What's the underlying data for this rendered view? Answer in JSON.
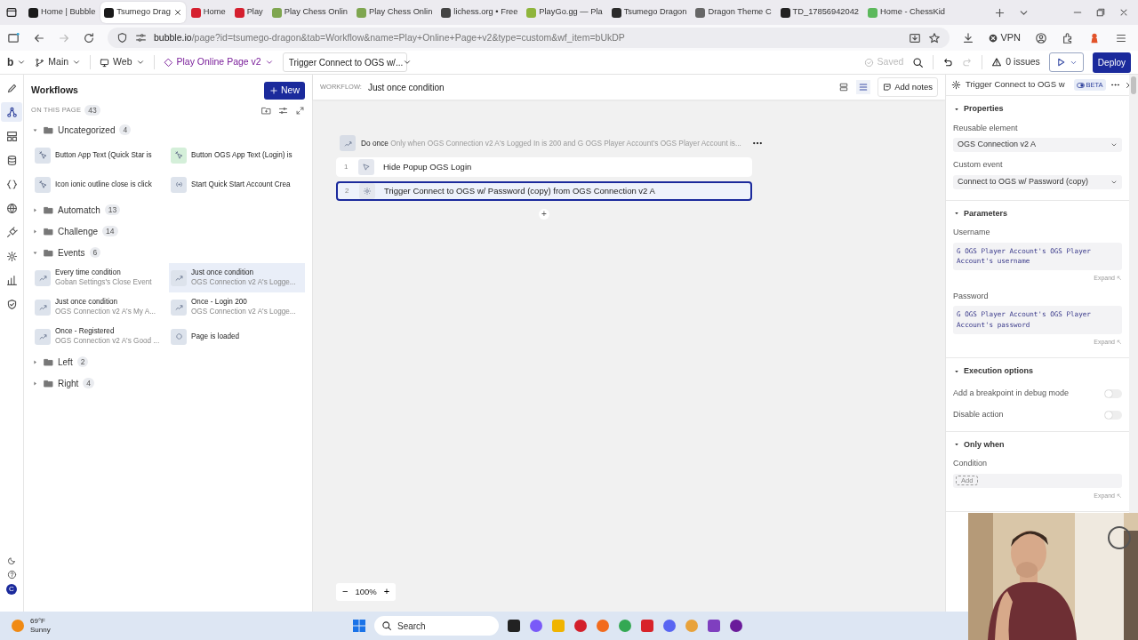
{
  "browser": {
    "tabs": [
      {
        "label": "Home | Bubble",
        "selected": false,
        "color": "#1a1a1a"
      },
      {
        "label": "Tsumego Drag",
        "selected": true,
        "color": "#1a1a1a"
      },
      {
        "label": "Home",
        "selected": false,
        "color": "#d5202f"
      },
      {
        "label": "Play",
        "selected": false,
        "color": "#d5202f"
      },
      {
        "label": "Play Chess Onlin",
        "selected": false,
        "color": "#7fa650"
      },
      {
        "label": "Play Chess Onlin",
        "selected": false,
        "color": "#7fa650"
      },
      {
        "label": "lichess.org • Free",
        "selected": false,
        "color": "#444444"
      },
      {
        "label": "PlayGo.gg — Pla",
        "selected": false,
        "color": "#8fb53c"
      },
      {
        "label": "Tsumego Dragon",
        "selected": false,
        "color": "#2b2b2b"
      },
      {
        "label": "Dragon Theme C",
        "selected": false,
        "color": "#666666"
      },
      {
        "label": "TD_17856942042",
        "selected": false,
        "color": "#222222"
      },
      {
        "label": "Home - ChessKid",
        "selected": false,
        "color": "#5cb85c"
      }
    ],
    "url_host": "bubble.io",
    "url_path": "/page?id=tsumego-dragon&tab=Workflow&name=Play+Online+Page+v2&type=custom&wf_item=bUkDP",
    "vpn": "VPN"
  },
  "editor_bar": {
    "logo": "b",
    "branch": "Main",
    "platform": "Web",
    "page": "Play Online Page v2",
    "element": "Trigger Connect to OGS w/...",
    "saved": "Saved",
    "issues": "0 issues",
    "deploy": "Deploy"
  },
  "rail": [
    {
      "kind": "design",
      "selected": false
    },
    {
      "kind": "workflow",
      "selected": true
    },
    {
      "kind": "styles",
      "selected": false
    },
    {
      "kind": "data",
      "selected": false
    },
    {
      "kind": "api",
      "selected": false
    },
    {
      "kind": "language",
      "selected": false
    },
    {
      "kind": "plugins",
      "selected": false
    },
    {
      "kind": "settings",
      "selected": false
    },
    {
      "kind": "logs",
      "selected": false
    },
    {
      "kind": "security",
      "selected": false
    }
  ],
  "user_initial": "C",
  "workflows": {
    "title": "Workflows",
    "new_button": "New",
    "section": "ON THIS PAGE",
    "count": "43",
    "folders": [
      {
        "name": "Uncategorized",
        "count": "4",
        "expanded": true,
        "items": [
          {
            "title": "Button App Text (Quick Star is",
            "kind": "click",
            "color": "#dde3ec",
            "selected": false
          },
          {
            "title": "Button OGS App Text (Login) is",
            "kind": "click",
            "color": "#d4efd9",
            "selected": false
          },
          {
            "title": "Icon ionic outline close is click",
            "kind": "click",
            "color": "#dde3ec",
            "selected": false
          },
          {
            "title": "Start Quick Start Account Crea",
            "kind": "custom",
            "color": "#dde3ec",
            "selected": false
          }
        ]
      },
      {
        "name": "Automatch",
        "count": "13",
        "expanded": false
      },
      {
        "name": "Challenge",
        "count": "14",
        "expanded": false
      },
      {
        "name": "Events",
        "count": "6",
        "expanded": true,
        "items": [
          {
            "title": "Every time condition",
            "subtitle": "Goban Settings's Close Event",
            "kind": "condition",
            "color": "#dde3ec",
            "selected": false
          },
          {
            "title": "Just once condition",
            "subtitle": "OGS Connection v2 A's Logge...",
            "kind": "condition",
            "color": "#dde3ec",
            "selected": true
          },
          {
            "title": "Just once condition",
            "subtitle": "OGS Connection v2 A's My A...",
            "kind": "condition",
            "color": "#dde3ec",
            "selected": false
          },
          {
            "title": "Once - Login 200",
            "subtitle": "OGS Connection v2 A's Logge...",
            "kind": "condition",
            "color": "#dde3ec",
            "selected": false
          },
          {
            "title": "Once - Registered",
            "subtitle": "OGS Connection v2 A's Good ...",
            "kind": "condition",
            "color": "#dde3ec",
            "selected": false
          },
          {
            "title": "Page is loaded",
            "kind": "load",
            "color": "#dde3ec",
            "selected": false
          }
        ]
      },
      {
        "name": "Left",
        "count": "2",
        "expanded": false
      },
      {
        "name": "Right",
        "count": "4",
        "expanded": false
      }
    ]
  },
  "canvas": {
    "label": "WORKFLOW:",
    "name": "Just once condition",
    "add_notes": "Add notes",
    "event": {
      "title": "Do once",
      "condition": "Only when OGS Connection v2 A's Logged In is 200 and G OGS Player Account's OGS Player Account is..."
    },
    "actions": [
      {
        "number": "1",
        "title": "Hide Popup OGS Login",
        "kind": "element",
        "selected": false
      },
      {
        "number": "2",
        "title": "Trigger Connect to OGS w/ Password (copy) from OGS Connection v2 A",
        "kind": "custom",
        "selected": true
      }
    ],
    "add_step": "+",
    "zoom_out": "−",
    "zoom": "100%",
    "zoom_in": "+"
  },
  "properties": {
    "title": "Trigger Connect to OGS w",
    "badge": "BETA",
    "sections": [
      {
        "title": "Properties",
        "expanded": true,
        "fields": [
          {
            "kind": "select",
            "label": "Reusable element",
            "value": "OGS Connection v2 A"
          },
          {
            "kind": "select",
            "label": "Custom event",
            "value": "Connect to OGS w/ Password (copy)"
          }
        ]
      },
      {
        "title": "Parameters",
        "expanded": true,
        "fields": [
          {
            "kind": "expression",
            "label": "Username",
            "value": "G OGS Player Account's OGS Player Account's username",
            "expand": "Expand"
          },
          {
            "kind": "expression",
            "label": "Password",
            "value": "G OGS Player Account's OGS Player Account's password",
            "expand": "Expand"
          }
        ]
      },
      {
        "title": "Execution options",
        "expanded": true,
        "fields": [
          {
            "kind": "toggle",
            "label": "Add a breakpoint in debug mode",
            "on": false
          },
          {
            "kind": "toggle",
            "label": "Disable action",
            "on": false
          }
        ]
      },
      {
        "title": "Only when",
        "expanded": true,
        "fields": [
          {
            "kind": "condition",
            "label": "Condition",
            "button": "Add",
            "expand": "Expand"
          }
        ]
      }
    ]
  },
  "taskbar": {
    "temperature": "69°F",
    "weather": "Sunny",
    "search_placeholder": "Search"
  }
}
